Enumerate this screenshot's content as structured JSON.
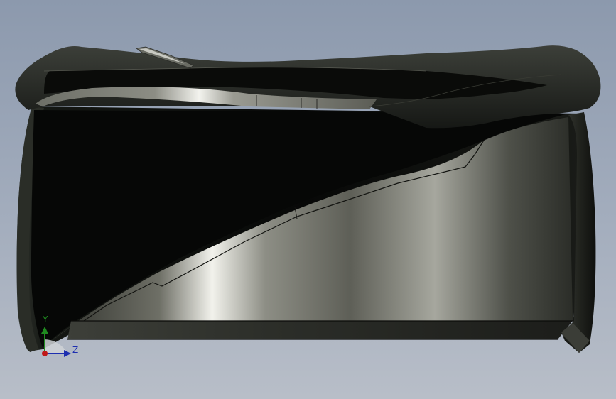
{
  "viewport": {
    "background_top": "#8c99ad",
    "background_bottom": "#b8bec8"
  },
  "model": {
    "body_color": "#0b0d0b",
    "highlight_color": "#e2e2dc",
    "shade_color": "#30332d"
  },
  "triad": {
    "y_label": "Y",
    "z_label": "Z",
    "y_color": "#1f8a1f",
    "z_color": "#1e2fb0",
    "x_color": "#c01818"
  }
}
